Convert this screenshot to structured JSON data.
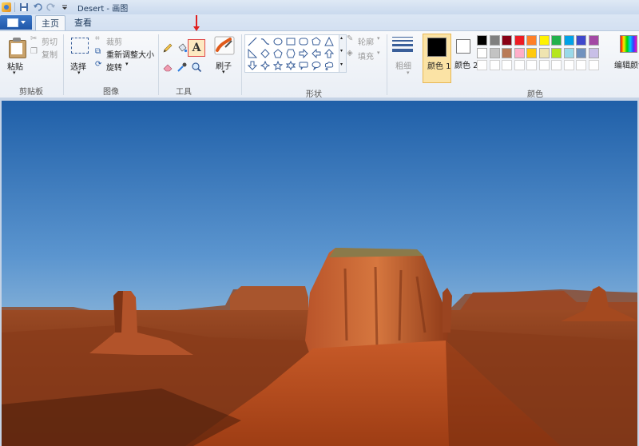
{
  "titlebar": {
    "title": "Desert - 画图",
    "quick_access": [
      "save-icon",
      "undo-icon",
      "redo-icon",
      "customize-dropdown-icon"
    ]
  },
  "tabs": [
    {
      "label": "主页",
      "active": true
    },
    {
      "label": "查看",
      "active": false
    }
  ],
  "clipboard": {
    "paste_label": "粘贴",
    "cut_label": "剪切",
    "copy_label": "复制",
    "group_label": "剪贴板"
  },
  "image": {
    "select_label": "选择",
    "crop_label": "裁剪",
    "resize_label": "重新调整大小",
    "rotate_label": "旋转",
    "group_label": "图像"
  },
  "tools": {
    "items": [
      "pencil-icon",
      "fill-icon",
      "text-icon",
      "eraser-icon",
      "color-picker-icon",
      "magnifier-icon"
    ],
    "selected": "text-icon",
    "text_tool_glyph": "A",
    "group_label": "工具"
  },
  "brushes": {
    "label": "刷子"
  },
  "shapes": {
    "outline_label": "轮廓",
    "fill_label": "填充",
    "group_label": "形状"
  },
  "size": {
    "label": "粗细"
  },
  "colors": {
    "color1_label": "颜色 1",
    "color2_label": "颜色 2",
    "color1_value": "#000000",
    "color2_value": "#ffffff",
    "edit_label": "编辑颜色",
    "group_label": "颜色",
    "palette_row1": [
      "#000000",
      "#7f7f7f",
      "#880015",
      "#ed1c24",
      "#ff7f27",
      "#fff200",
      "#22b14c",
      "#00a2e8",
      "#3f48cc",
      "#a349a4"
    ],
    "palette_row2": [
      "#ffffff",
      "#c3c3c3",
      "#b97a57",
      "#ffaec9",
      "#ffc90e",
      "#efe4b0",
      "#b5e61d",
      "#99d9ea",
      "#7092be",
      "#c8bfe7"
    ]
  },
  "accent": {
    "annotation_red": "#e02020",
    "selection_yellow": "#fbe3a5"
  }
}
